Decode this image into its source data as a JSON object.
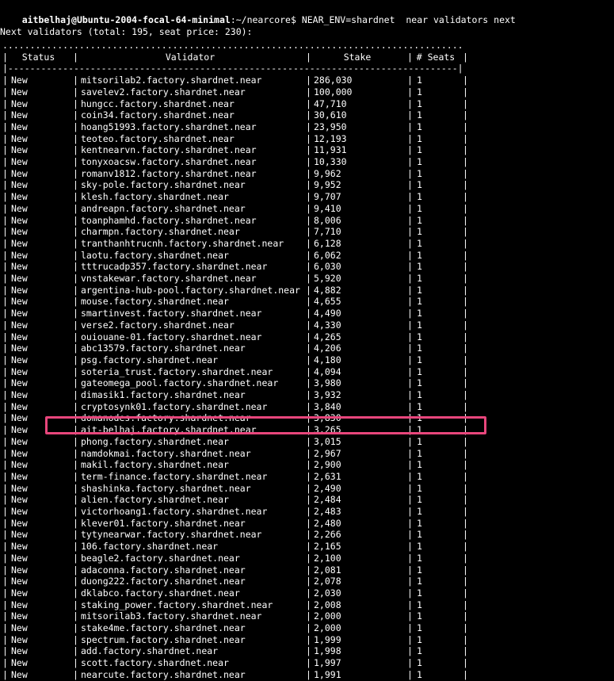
{
  "terminal": {
    "prompt": {
      "user_host": "aitbelhaj@Ubuntu-2004-focal-64-minimal",
      "path": ":~/nearcore$ ",
      "command": "NEAR_ENV=shardnet  near validators next"
    },
    "heading": "Next validators (total: 195, seat price: 230):",
    "highlight_color": "#e8467c"
  },
  "table": {
    "headers": [
      "Status",
      "Validator",
      "Stake",
      "# Seats"
    ],
    "rows": [
      [
        "New",
        "mitsorilab2.factory.shardnet.near",
        "286,030",
        "1"
      ],
      [
        "New",
        "savelev2.factory.shardnet.near",
        "100,000",
        "1"
      ],
      [
        "New",
        "hungcc.factory.shardnet.near",
        "47,710",
        "1"
      ],
      [
        "New",
        "coin34.factory.shardnet.near",
        "30,610",
        "1"
      ],
      [
        "New",
        "hoang51993.factory.shardnet.near",
        "23,950",
        "1"
      ],
      [
        "New",
        "teoteo.factory.shardnet.near",
        "12,193",
        "1"
      ],
      [
        "New",
        "kentnearvn.factory.shardnet.near",
        "11,931",
        "1"
      ],
      [
        "New",
        "tonyxoacsw.factory.shardnet.near",
        "10,330",
        "1"
      ],
      [
        "New",
        "romanv1812.factory.shardnet.near",
        "9,962",
        "1"
      ],
      [
        "New",
        "sky-pole.factory.shardnet.near",
        "9,952",
        "1"
      ],
      [
        "New",
        "klesh.factory.shardnet.near",
        "9,707",
        "1"
      ],
      [
        "New",
        "andreapn.factory.shardnet.near",
        "9,410",
        "1"
      ],
      [
        "New",
        "toanphamhd.factory.shardnet.near",
        "8,006",
        "1"
      ],
      [
        "New",
        "charmpn.factory.shardnet.near",
        "7,710",
        "1"
      ],
      [
        "New",
        "tranthanhtrucnh.factory.shardnet.near",
        "6,128",
        "1"
      ],
      [
        "New",
        "laotu.factory.shardnet.near",
        "6,062",
        "1"
      ],
      [
        "New",
        "tttrucadp357.factory.shardnet.near",
        "6,030",
        "1"
      ],
      [
        "New",
        "vnstakewar.factory.shardnet.near",
        "5,920",
        "1"
      ],
      [
        "New",
        "argentina-hub-pool.factory.shardnet.near",
        "4,882",
        "1"
      ],
      [
        "New",
        "mouse.factory.shardnet.near",
        "4,655",
        "1"
      ],
      [
        "New",
        "smartinvest.factory.shardnet.near",
        "4,490",
        "1"
      ],
      [
        "New",
        "verse2.factory.shardnet.near",
        "4,330",
        "1"
      ],
      [
        "New",
        "ouiouane-01.factory.shardnet.near",
        "4,265",
        "1"
      ],
      [
        "New",
        "abc13579.factory.shardnet.near",
        "4,206",
        "1"
      ],
      [
        "New",
        "psg.factory.shardnet.near",
        "4,180",
        "1"
      ],
      [
        "New",
        "soteria_trust.factory.shardnet.near",
        "4,094",
        "1"
      ],
      [
        "New",
        "gateomega_pool.factory.shardnet.near",
        "3,980",
        "1"
      ],
      [
        "New",
        "dimasik1.factory.shardnet.near",
        "3,932",
        "1"
      ],
      [
        "New",
        "cryptosynk01.factory.shardnet.near",
        "3,840",
        "1"
      ],
      [
        "New",
        "domanodes.factory.shardnet.near",
        "3,830",
        "1"
      ],
      [
        "New",
        "ait-belhaj.factory.shardnet.near",
        "3,265",
        "1"
      ],
      [
        "New",
        "phong.factory.shardnet.near",
        "3,015",
        "1"
      ],
      [
        "New",
        "namdokmai.factory.shardnet.near",
        "2,967",
        "1"
      ],
      [
        "New",
        "makil.factory.shardnet.near",
        "2,900",
        "1"
      ],
      [
        "New",
        "term-finance.factory.shardnet.near",
        "2,631",
        "1"
      ],
      [
        "New",
        "shashinka.factory.shardnet.near",
        "2,490",
        "1"
      ],
      [
        "New",
        "alien.factory.shardnet.near",
        "2,484",
        "1"
      ],
      [
        "New",
        "victorhoang1.factory.shardnet.near",
        "2,483",
        "1"
      ],
      [
        "New",
        "klever01.factory.shardnet.near",
        "2,480",
        "1"
      ],
      [
        "New",
        "tytynearwar.factory.shardnet.near",
        "2,266",
        "1"
      ],
      [
        "New",
        "106.factory.shardnet.near",
        "2,165",
        "1"
      ],
      [
        "New",
        "beagle2.factory.shardnet.near",
        "2,100",
        "1"
      ],
      [
        "New",
        "adaconna.factory.shardnet.near",
        "2,081",
        "1"
      ],
      [
        "New",
        "duong222.factory.shardnet.near",
        "2,078",
        "1"
      ],
      [
        "New",
        "dklabco.factory.shardnet.near",
        "2,030",
        "1"
      ],
      [
        "New",
        "staking_power.factory.shardnet.near",
        "2,008",
        "1"
      ],
      [
        "New",
        "mitsorilab3.factory.shardnet.near",
        "2,000",
        "1"
      ],
      [
        "New",
        "stake4me.factory.shardnet.near",
        "2,000",
        "1"
      ],
      [
        "New",
        "spectrum.factory.shardnet.near",
        "1,999",
        "1"
      ],
      [
        "New",
        "add.factory.shardnet.near",
        "1,998",
        "1"
      ],
      [
        "New",
        "scott.factory.shardnet.near",
        "1,997",
        "1"
      ],
      [
        "New",
        "nearcute.factory.shardnet.near",
        "1,991",
        "1"
      ]
    ]
  }
}
